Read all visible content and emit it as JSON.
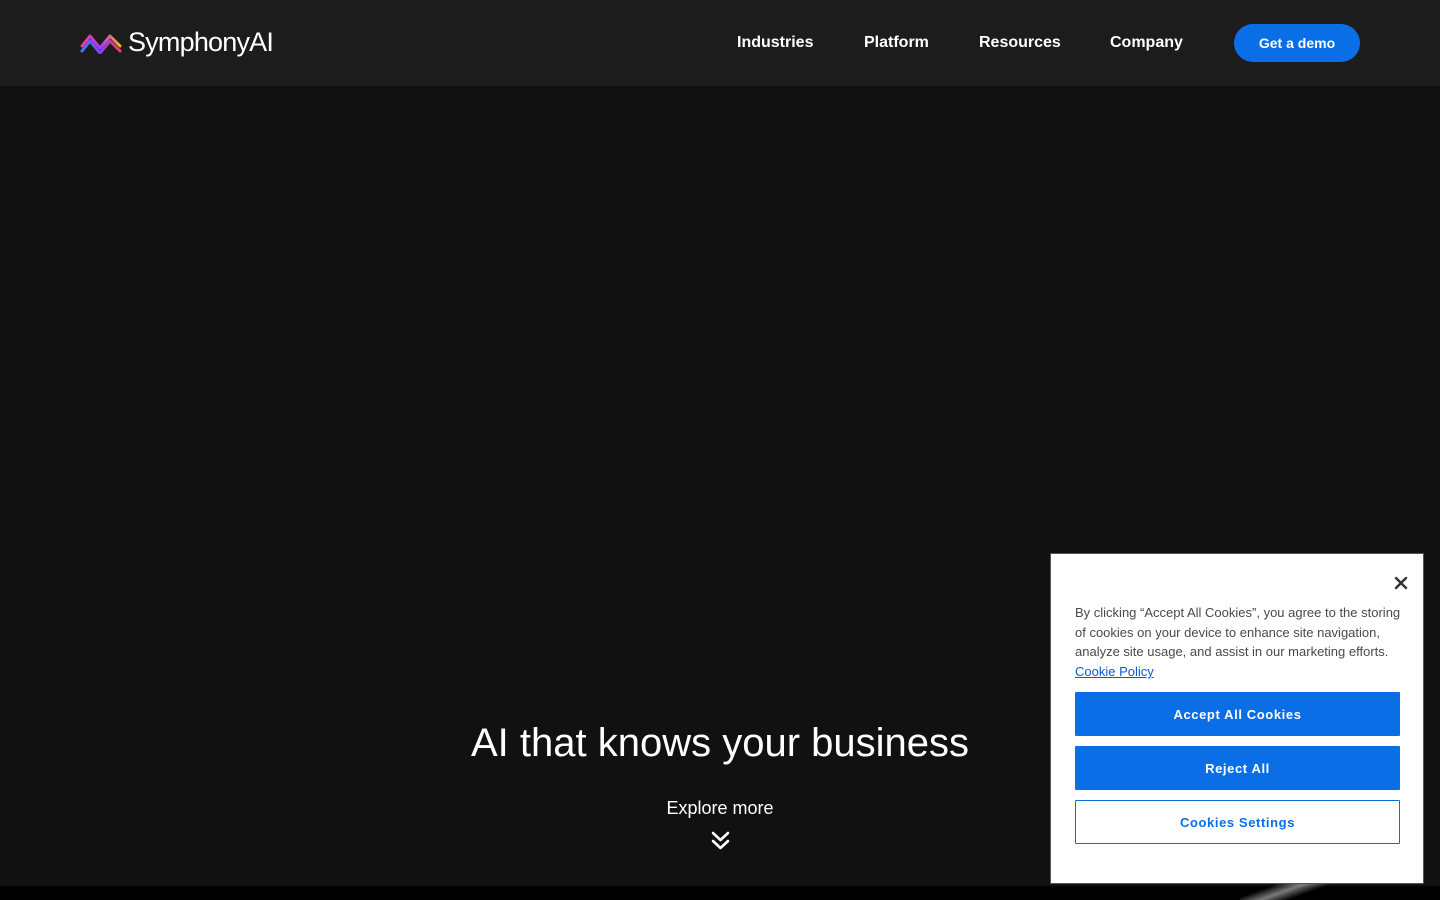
{
  "header": {
    "logo_text": "SymphonyAI",
    "logo_icon": "symphonyai-wave-logo",
    "nav": {
      "industries": "Industries",
      "platform": "Platform",
      "resources": "Resources",
      "company": "Company"
    },
    "demo_button": "Get a demo"
  },
  "hero": {
    "title": "AI that knows your business",
    "explore": "Explore more",
    "explore_icon": "double-chevron-down-icon"
  },
  "cookie_banner": {
    "text": "By clicking “Accept All Cookies”, you agree to the storing of cookies on your device to enhance site navigation, analyze site usage, and assist in our marketing efforts.",
    "policy_link": "Cookie Policy",
    "accept_all": "Accept All Cookies",
    "reject_all": "Reject All",
    "settings": "Cookies Settings",
    "close_icon": "close-icon"
  },
  "colors": {
    "page_background": "#111111",
    "header_background": "#1c1c1c",
    "accent": "#0a6fe6",
    "link": "#0a5bd6"
  }
}
